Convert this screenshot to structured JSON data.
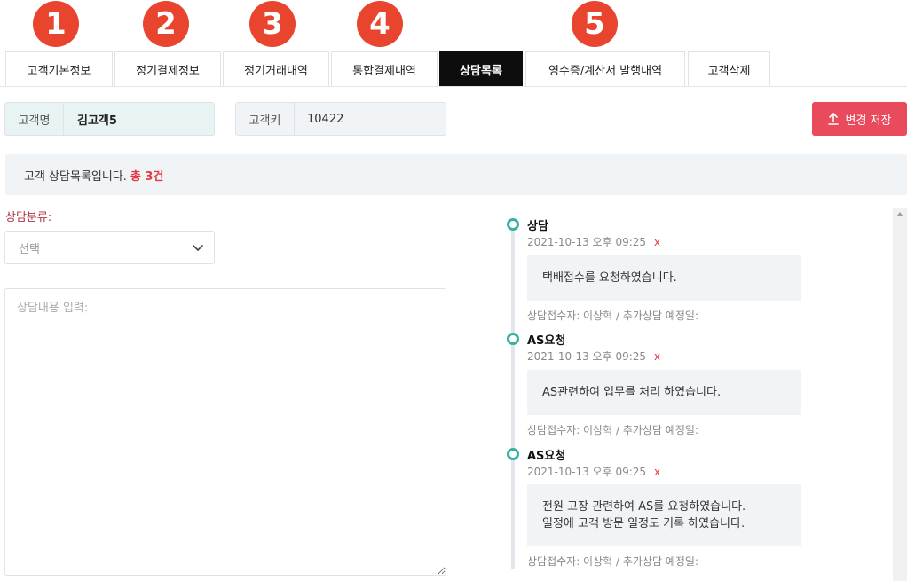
{
  "badges": [
    "1",
    "2",
    "3",
    "4",
    "5"
  ],
  "tabs": [
    {
      "label": "고객기본정보",
      "active": false
    },
    {
      "label": "정기결제정보",
      "active": false
    },
    {
      "label": "정기거래내역",
      "active": false
    },
    {
      "label": "통합결제내역",
      "active": false
    },
    {
      "label": "상담목록",
      "active": true
    },
    {
      "label": "영수증/계산서 발행내역",
      "active": false
    },
    {
      "label": "고객삭제",
      "active": false
    }
  ],
  "customer": {
    "name_label": "고객명",
    "name_value": "김고객5",
    "key_label": "고객키",
    "key_value": "10422"
  },
  "actions": {
    "save_label": "변경 저장",
    "save_icon": "upload-icon",
    "save_color": "#e94a5c"
  },
  "notice": {
    "text": "고객 상담목록입니다.",
    "count": "총 3건"
  },
  "form": {
    "category_label": "상담분류:",
    "category_selected": "선택",
    "content_placeholder": "상담내용 입력:"
  },
  "consultations": [
    {
      "title": "상담",
      "date": "2021-10-13 오후 09:25",
      "delete": "x",
      "lines": [
        "택배접수를 요청하였습니다."
      ],
      "meta": "상담접수자: 이상혁 / 추가상담 예정일:"
    },
    {
      "title": "AS요청",
      "date": "2021-10-13 오후 09:25",
      "delete": "x",
      "lines": [
        "AS관련하여 업무를 처리 하였습니다."
      ],
      "meta": "상담접수자: 이상혁 / 추가상담 예정일:"
    },
    {
      "title": "AS요청",
      "date": "2021-10-13 오후 09:25",
      "delete": "x",
      "lines": [
        "전원 고장 관련하여 AS를 요청하였습니다.",
        "일정에 고객 방문 일정도 기록 하였습니다."
      ],
      "meta": "상담접수자: 이상혁 / 추가상담 예정일:"
    }
  ],
  "colors": {
    "badge": "#e8442e",
    "active_tab": "#0d0d0d",
    "timeline_dot": "#3ab0a3",
    "count": "#e53945"
  }
}
